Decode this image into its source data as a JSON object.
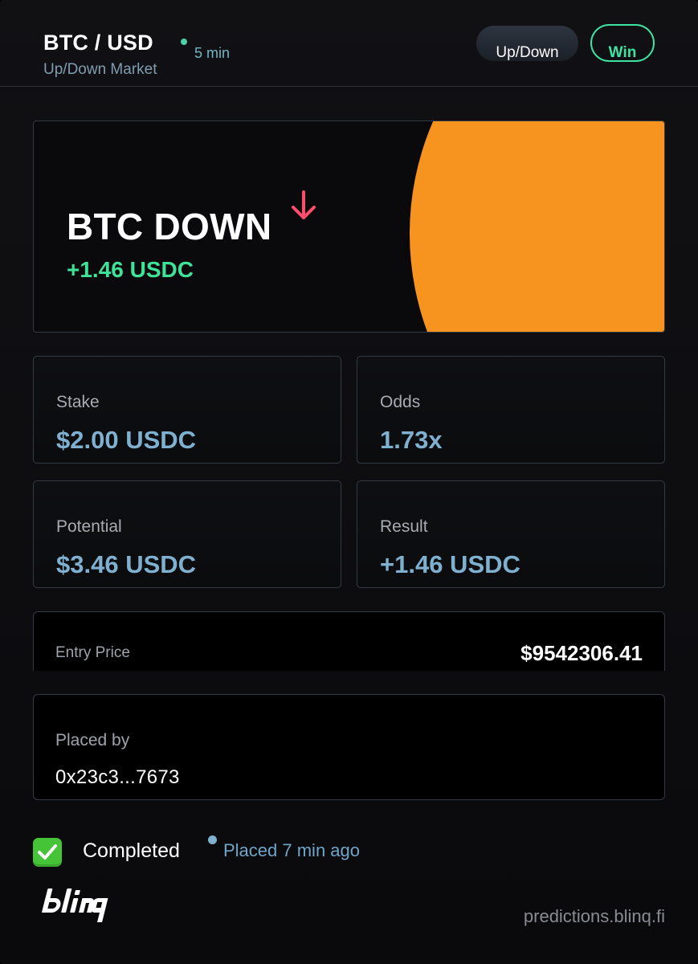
{
  "header": {
    "pair": "BTC / USD",
    "market_type": "Up/Down Market",
    "interval": "5 min",
    "mode_label": "Up/Down",
    "outcome_label": "Win"
  },
  "hero": {
    "title": "BTC DOWN",
    "direction_icon": "arrow-down-icon",
    "gain": "+1.46 USDC"
  },
  "stats": [
    {
      "label": "Stake",
      "value": "$2.00 USDC"
    },
    {
      "label": "Odds",
      "value": "1.73x"
    },
    {
      "label": "Potential",
      "value": "$3.46 USDC"
    },
    {
      "label": "Result",
      "value": "+1.46 USDC"
    }
  ],
  "entry": {
    "label": "Entry Price",
    "value": "$9542306.41"
  },
  "placed_by": {
    "label": "Placed by",
    "value": "0x23c3...7673"
  },
  "footer": {
    "status": "Completed",
    "placed_ago": "Placed 7 min ago",
    "brand": "blinq",
    "site": "predictions.blinq.fi"
  },
  "colors": {
    "accent_orange": "#f7931f",
    "gain_green": "#3ee39a",
    "value_blue": "#7fb0cf",
    "down_red": "#ff4d6d"
  }
}
